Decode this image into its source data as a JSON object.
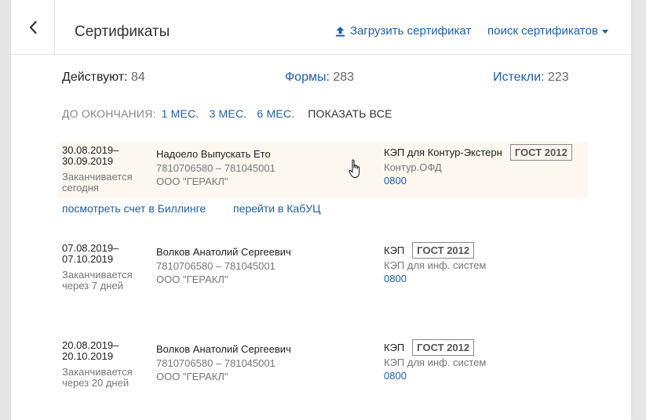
{
  "header": {
    "back_icon": "chevron-left-icon",
    "title": "Сертификаты",
    "upload_icon": "upload-icon",
    "upload_label": "Загрузить сертификат",
    "search_label": "поиск сертификатов"
  },
  "counts": {
    "active_label": "Действуют:",
    "active_value": "84",
    "forms_label": "Формы:",
    "forms_value": "283",
    "expired_label": "Истекли:",
    "expired_value": "223"
  },
  "filters": {
    "label": "ДО ОКОНЧАНИЯ:",
    "options": [
      "1 МЕС.",
      "3 МЕС.",
      "6 МЕС."
    ],
    "show_all": "ПОКАЗАТЬ ВСЕ"
  },
  "certificates": [
    {
      "date_from": "30.08.2019–",
      "date_to": "30.09.2019",
      "until_line1": "Заканчивается",
      "until_line2": "сегодня",
      "owner": "Надоело Выпускать Ето",
      "inn_kpp": "7810706580 – 781045001",
      "org": "ООО \"ГЕРАКЛ\"",
      "type": "КЭП для Контур-Экстерн",
      "badge": "ГОСТ 2012",
      "subtype": "Контур.ОФД",
      "code": "0800"
    },
    {
      "date_from": "07.08.2019–",
      "date_to": "07.10.2019",
      "until_line1": "Заканчивается",
      "until_line2": "через 7 дней",
      "owner": "Волков Анатолий Сергеевич",
      "inn_kpp": "7810706580 – 781045001",
      "org": "ООО \"ГЕРАКЛ\"",
      "type": "КЭП",
      "badge": "ГОСТ 2012",
      "subtype": "КЭП для инф. систем",
      "code": "0800"
    },
    {
      "date_from": "20.08.2019–",
      "date_to": "20.10.2019",
      "until_line1": "Заканчивается",
      "until_line2": "через 20 дней",
      "owner": "Волков Анатолий Сергеевич",
      "inn_kpp": "7810706580 – 781045001",
      "org": "ООО \"ГЕРАКЛ\"",
      "type": "КЭП",
      "badge": "ГОСТ 2012",
      "subtype": "КЭП для инф. систем",
      "code": "0800"
    }
  ],
  "actions": {
    "billing": "посмотреть счет в Биллинге",
    "kabuc": "перейти в КабУЦ"
  },
  "colors": {
    "link": "#1f5fb0",
    "highlight_row": "#fdf8ef",
    "background": "#e6e6e6"
  }
}
